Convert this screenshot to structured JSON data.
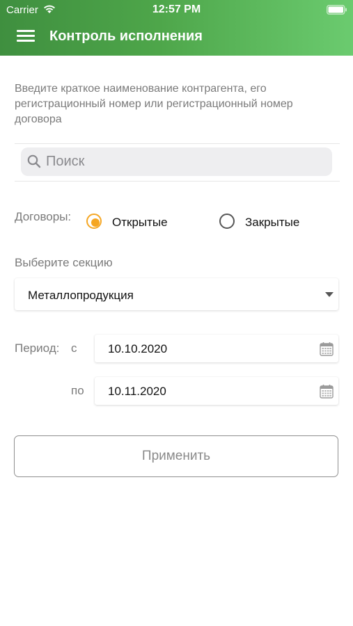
{
  "status_bar": {
    "carrier": "Carrier",
    "time": "12:57 PM"
  },
  "header": {
    "title": "Контроль исполнения",
    "menu_icon": "hamburger-menu-icon",
    "background_start": "#3f8f3f",
    "background_end": "#6bcb6f"
  },
  "hint": {
    "text": "Введите краткое наименование контрагента, его регистрационный номер или регистрационный номер договора"
  },
  "search": {
    "placeholder": "Поиск",
    "value": "",
    "icon": "search-icon"
  },
  "contracts": {
    "label": "Договоры:",
    "options": [
      {
        "label": "Открытые",
        "selected": true
      },
      {
        "label": "Закрытые",
        "selected": false
      }
    ],
    "accent_color": "#f5a623"
  },
  "section": {
    "label": "Выберите секцию",
    "selected": "Металлопродукция"
  },
  "period": {
    "label": "Период:",
    "from_label": "с",
    "to_label": "по",
    "from_value": "10.10.2020",
    "to_value": "10.11.2020",
    "icon": "calendar-icon"
  },
  "apply_button": {
    "label": "Применить"
  }
}
